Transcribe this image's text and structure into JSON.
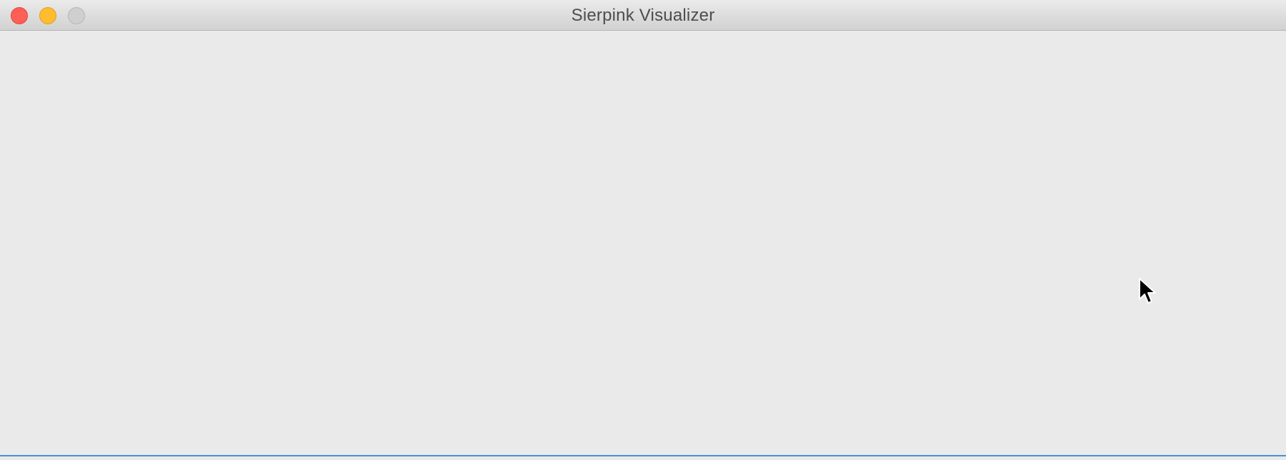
{
  "window": {
    "title": "Sierpink Visualizer"
  },
  "colors": {
    "close_button": "#fe5f57",
    "minimize_button": "#febc2e",
    "zoom_button_disabled": "#cfcfcf",
    "content_background": "#eaeaea",
    "bottom_focus_accent": "#4a90d9"
  },
  "icons": {
    "close": "close-icon",
    "minimize": "minimize-icon",
    "zoom": "zoom-icon",
    "cursor": "mouse-pointer-icon"
  }
}
